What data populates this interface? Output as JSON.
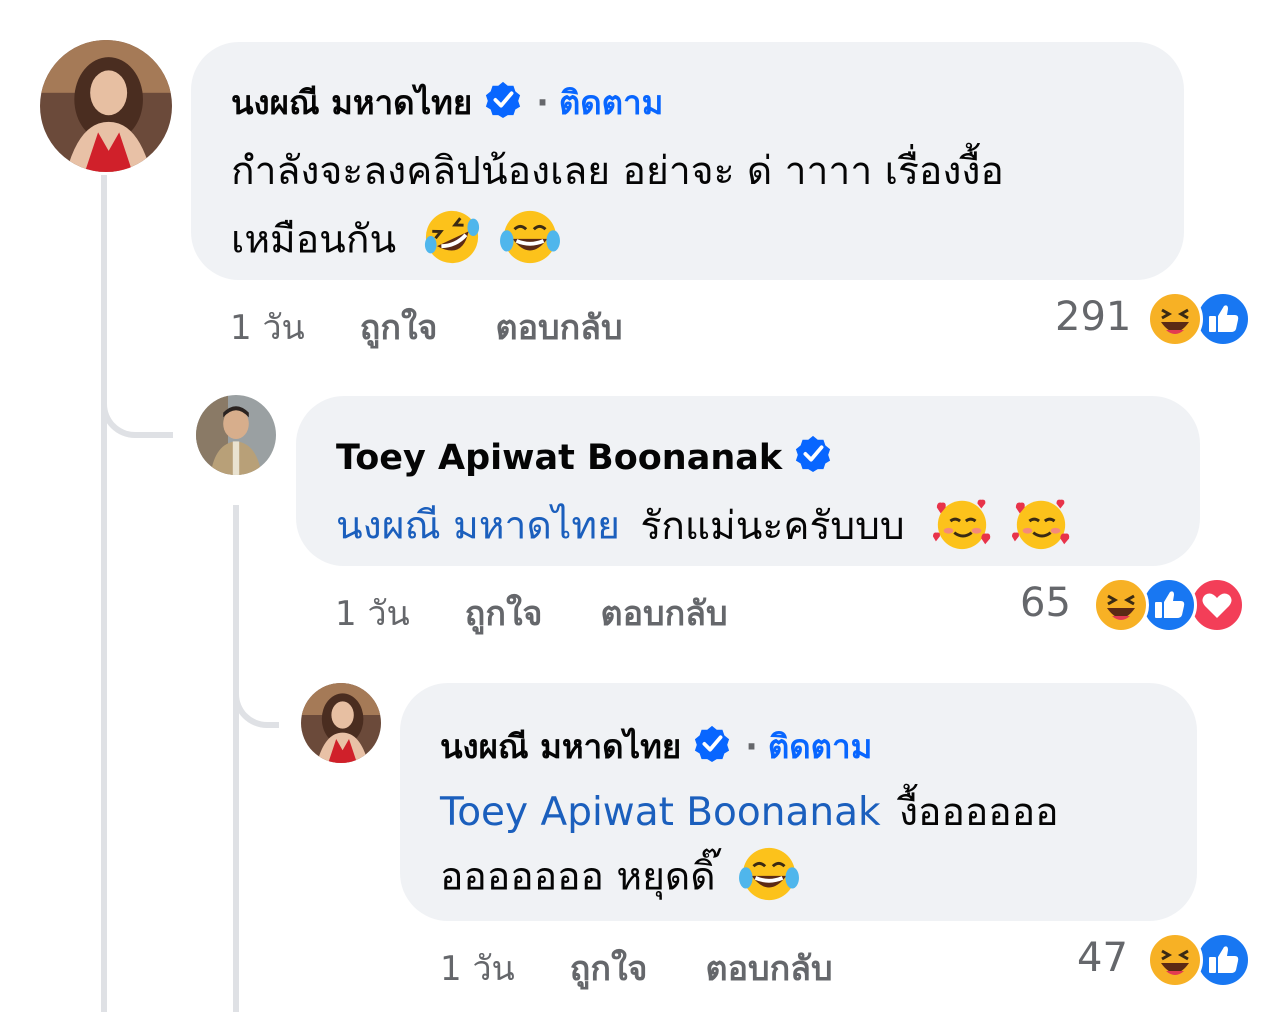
{
  "comments": [
    {
      "author": "นงผณี มหาดไทย",
      "follow": "ติดตาม",
      "separator": "·",
      "line1": "กำลังจะลงคลิปน้องเลย อย่าจะ ด่ าาาา เรื่องงื้อ",
      "line2": "เหมือนกัน",
      "emojis": [
        "rolling-laughing-emoji",
        "tears-of-joy-emoji"
      ],
      "time": "1 วัน",
      "like": "ถูกใจ",
      "reply": "ตอบกลับ",
      "reaction_count": "291",
      "reactions": [
        "haha",
        "like"
      ]
    },
    {
      "author": "Toey Apiwat Boonanak",
      "mention": "นงผณี มหาดไทย",
      "line1": "รักแม่นะครับบบ",
      "emojis": [
        "smiling-hearts-emoji",
        "smiling-hearts-emoji"
      ],
      "time": "1 วัน",
      "like": "ถูกใจ",
      "reply": "ตอบกลับ",
      "reaction_count": "65",
      "reactions": [
        "haha",
        "like",
        "love"
      ]
    },
    {
      "author": "นงผณี มหาดไทย",
      "follow": "ติดตาม",
      "separator": "·",
      "mention": "Toey Apiwat Boonanak",
      "line1": "งื้ออออออ",
      "line2": "อออออออ หยุดดิ๊",
      "emojis": [
        "tears-of-joy-emoji"
      ],
      "time": "1 วัน",
      "like": "ถูกใจ",
      "reply": "ตอบกลับ",
      "reaction_count": "47",
      "reactions": [
        "haha",
        "like"
      ]
    }
  ],
  "colors": {
    "bubble": "#f0f2f5",
    "follow_blue": "#0866ff",
    "mention_blue": "#1b5fbd",
    "verified": "#0866ff",
    "meta_gray": "#65676b",
    "thread_line": "#dfe1e5",
    "like_blue": "#1877f2",
    "love_red": "#f33e58",
    "haha_yellow": "#f7b125"
  }
}
